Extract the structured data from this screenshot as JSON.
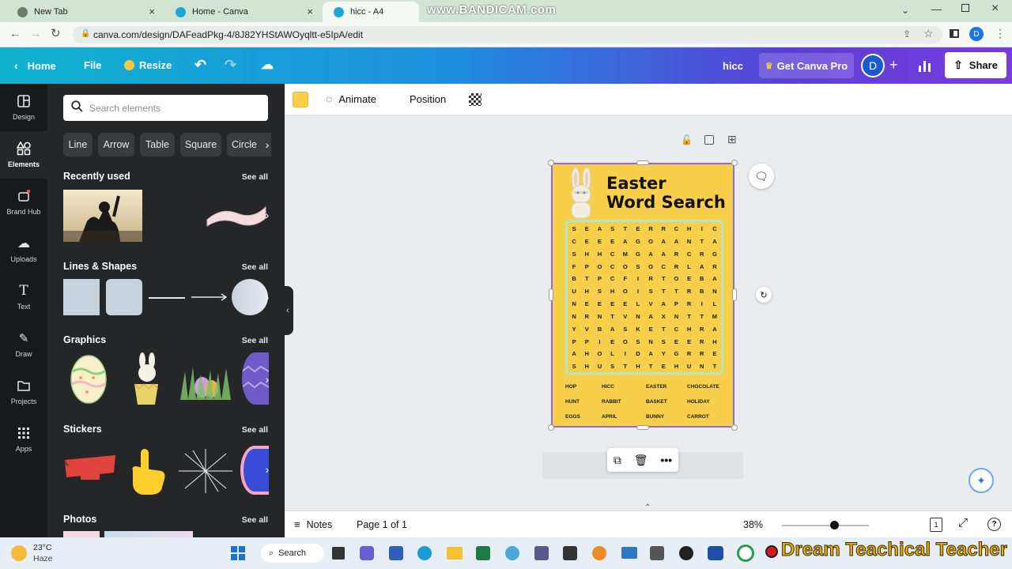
{
  "browser": {
    "tabs": [
      {
        "label": "New Tab"
      },
      {
        "label": "Home - Canva"
      },
      {
        "label": "hicc - A4"
      }
    ],
    "url": "canva.com/design/DAFeadPkg-4/8J82YHStAWOyqltt-e5IpA/edit",
    "profile_initial": "D",
    "watermark": "www.BANDICAM.com"
  },
  "topbar": {
    "home": "Home",
    "file": "File",
    "resize": "Resize",
    "doc_title": "hicc",
    "get_pro": "Get Canva Pro",
    "avatar": "D",
    "share": "Share"
  },
  "nav": [
    {
      "label": "Design"
    },
    {
      "label": "Elements"
    },
    {
      "label": "Brand Hub"
    },
    {
      "label": "Uploads"
    },
    {
      "label": "Text"
    },
    {
      "label": "Draw"
    },
    {
      "label": "Projects"
    },
    {
      "label": "Apps"
    }
  ],
  "panel": {
    "search_placeholder": "Search elements",
    "chips": [
      "Line",
      "Arrow",
      "Table",
      "Square",
      "Circle"
    ],
    "sections": {
      "recent": "Recently used",
      "lines": "Lines & Shapes",
      "graphics": "Graphics",
      "stickers": "Stickers",
      "photos": "Photos"
    },
    "see_all": "See all"
  },
  "toolbar": {
    "animate": "Animate",
    "position": "Position",
    "color": "#f8cf4a"
  },
  "design": {
    "title_line1": "Easter",
    "title_line2": "Word Search",
    "grid": [
      "SEASTERRCHIC",
      "CEEEAGOAANTA",
      "SHHCMGAARCRG",
      "FPOCOSOCRLAR",
      "BTPCFIRTOEBA",
      "UHSHOISTTRBN",
      "NEEEELVAPRIL",
      "NRNTVNAXNTTM",
      "YVBASKETCHRA",
      "PPIEOSNSEERH",
      "AHOLIDAYGRRE",
      "SHUSTHTEHUNT"
    ],
    "words": [
      [
        "HOP",
        "HICC",
        "EASTER",
        "CHOCOLATE"
      ],
      [
        "HUNT",
        "RABBIT",
        "BASKET",
        "HOLIDAY"
      ],
      [
        "EGGS",
        "APRIL",
        "BUNNY",
        "CARROT"
      ]
    ]
  },
  "bottombar": {
    "notes": "Notes",
    "page": "Page 1 of 1",
    "zoom": "38%",
    "zoom_fraction": 0.38,
    "page_count": "1"
  },
  "taskbar": {
    "temp": "23°C",
    "weather": "Haze",
    "search": "Search",
    "overlay": "Dream Teachical Teacher"
  }
}
